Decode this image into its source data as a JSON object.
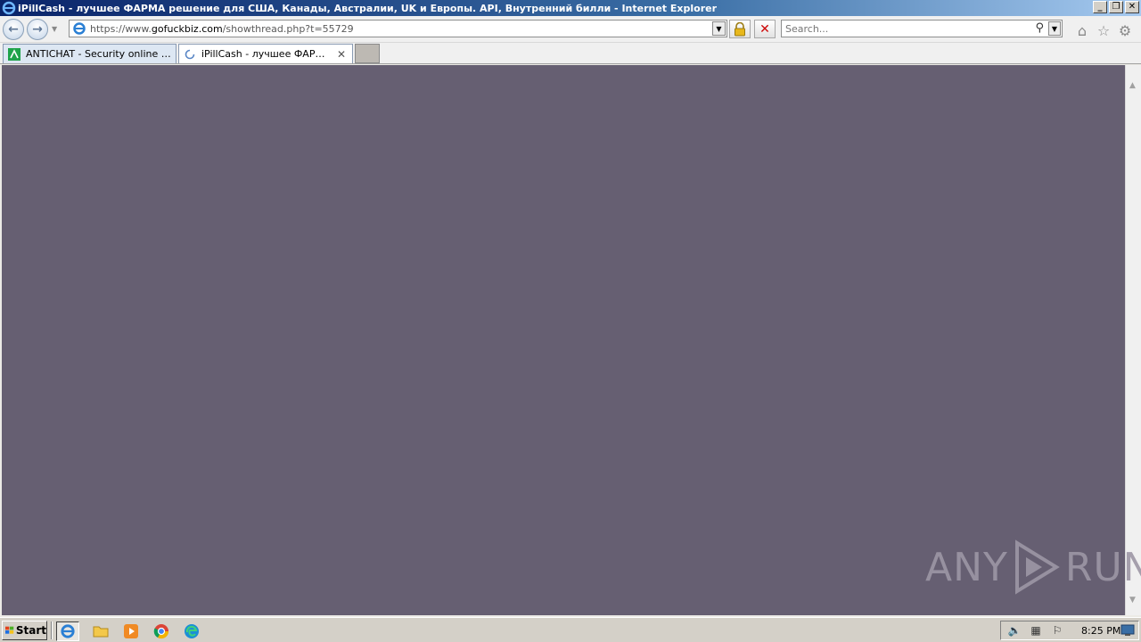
{
  "window": {
    "title": "iPillCash - лучшее ФАРМА решение для США, Канады, Австралии, UK и Европы. API, Внутренний билли - Internet Explorer",
    "controls": {
      "minimize": "_",
      "maximize": "❐",
      "close": "✕"
    }
  },
  "navbar": {
    "url_prefix": "https://www.",
    "url_host": "gofuckbiz.com",
    "url_path": "/showthread.php?t=55729",
    "search_placeholder": "Search..."
  },
  "tabs": [
    {
      "label": "ANTICHAT - Security online com...",
      "active": false
    },
    {
      "label": "iPillCash - лучшее ФАРМА р...",
      "active": true,
      "loading": true
    }
  ],
  "content": {
    "background": "#665f72"
  },
  "watermark": {
    "left": "ANY",
    "right": "RUN"
  },
  "taskbar": {
    "start_label": "Start",
    "clock": "8:25 PM",
    "quick_launch": [
      "ie-icon",
      "folder-icon",
      "media-player-icon",
      "chrome-icon",
      "edge-icon"
    ]
  }
}
